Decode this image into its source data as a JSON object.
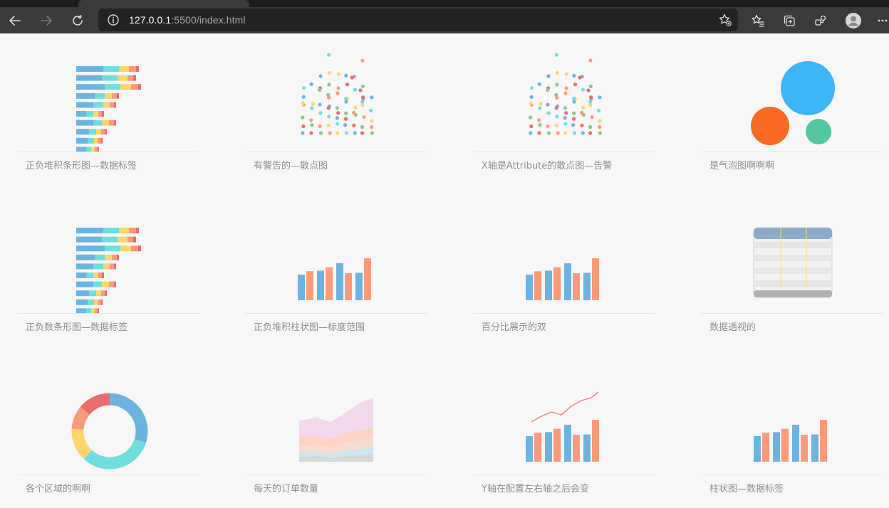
{
  "browser": {
    "url_host": "127.0.0.1",
    "url_rest": ":5500/index.html",
    "colors": {
      "toolbar": "#3a3a3c",
      "address_bar": "#232325",
      "icon": "#d8d8d8"
    }
  },
  "cards": [
    {
      "caption": "正负堆积条形图—数据标签",
      "thumb": "stacked-hbar"
    },
    {
      "caption": "有警告的—散点图",
      "thumb": "scatter"
    },
    {
      "caption": "X轴是Attribute的散点图—告警",
      "thumb": "scatter"
    },
    {
      "caption": "是气泡图啊啊啊",
      "thumb": "bubble"
    },
    {
      "caption": "正负数条形图—数据标签",
      "thumb": "stacked-hbar"
    },
    {
      "caption": "正负堆积柱状图—标度范围",
      "thumb": "columns"
    },
    {
      "caption": "百分比展示的双",
      "thumb": "columns"
    },
    {
      "caption": "数据透视的",
      "thumb": "pivot-table"
    },
    {
      "caption": "各个区域的啊啊",
      "thumb": "donut"
    },
    {
      "caption": "每天的订单数量",
      "thumb": "area"
    },
    {
      "caption": "Y轴在配置左右轴之后会变",
      "thumb": "columns-line"
    },
    {
      "caption": "柱状图—数据标签",
      "thumb": "columns"
    }
  ],
  "palette": {
    "blue": "#6cb3e0",
    "cyan": "#70dede",
    "yellow": "#fcd56b",
    "orange": "#fb9a7a",
    "red": "#ec6b6b",
    "green": "#8bc78b",
    "pink": "#f0a0a0"
  }
}
